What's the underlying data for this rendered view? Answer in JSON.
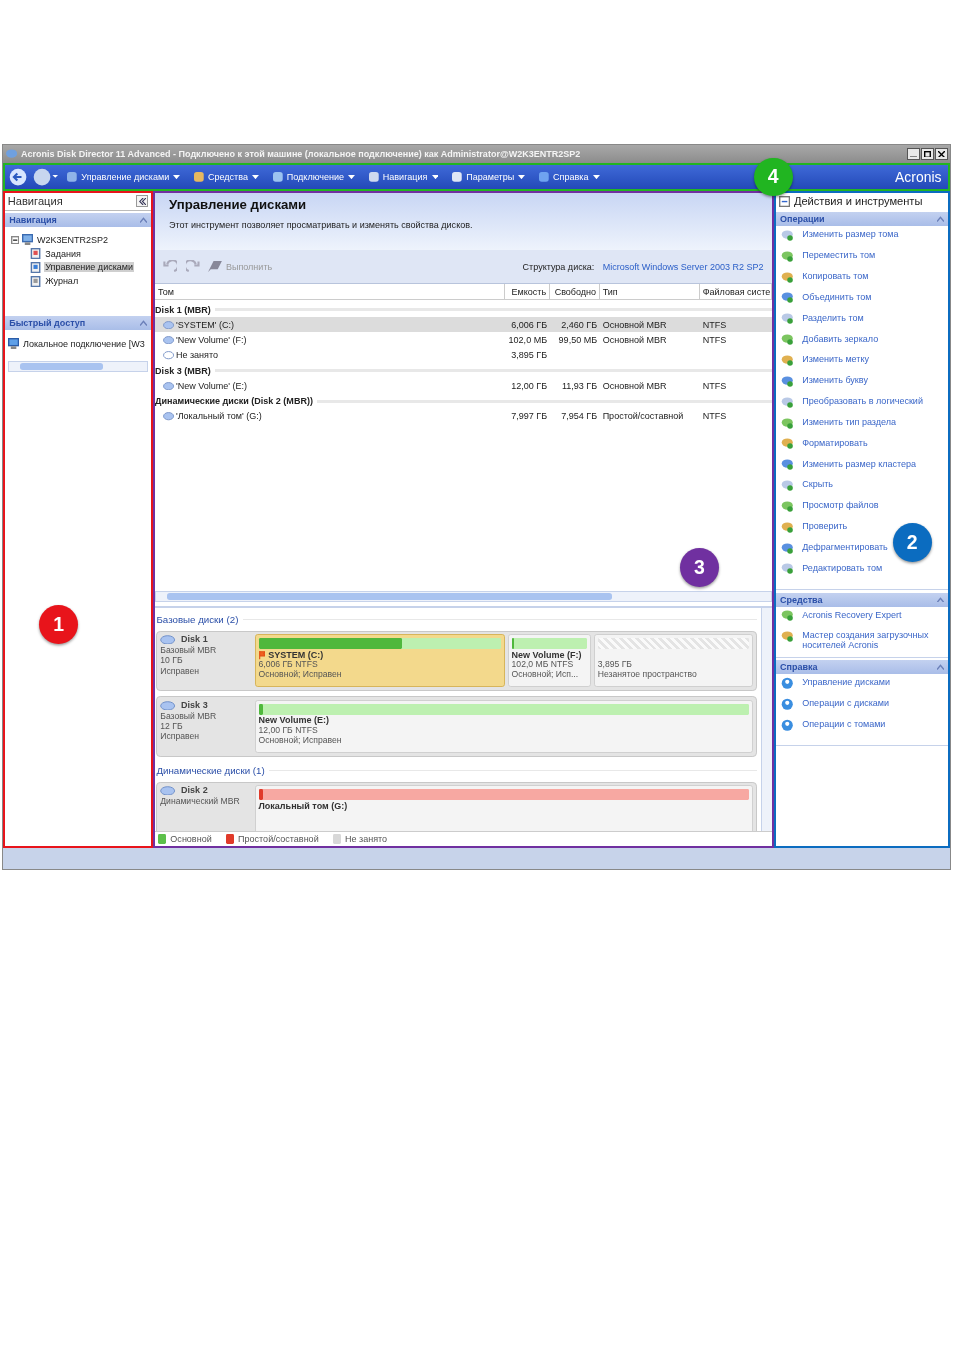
{
  "window": {
    "title": "Acronis Disk Director 11 Advanced - Подключено к этой машине (локальное подключение) как Administrator@W2K3ENTR2SP2"
  },
  "toolbar": {
    "menus": [
      "Управление дисками",
      "Средства",
      "Подключение",
      "Навигация",
      "Параметры",
      "Справка"
    ],
    "logo": "Acronis"
  },
  "navigation": {
    "title": "Навигация",
    "sections": [
      {
        "title": "Навигация",
        "tree": [
          {
            "label": "W2K3ENTR2SP2",
            "expanded": true,
            "selected": false,
            "children": [
              {
                "label": "Задания",
                "selected": false
              },
              {
                "label": "Управление дисками",
                "selected": true
              },
              {
                "label": "Журнал",
                "selected": false
              }
            ]
          }
        ]
      },
      {
        "title": "Быстрый доступ",
        "items": [
          "Локальное подключение [W3"
        ]
      }
    ]
  },
  "main": {
    "title": "Управление дисками",
    "description": "Этот инструмент позволяет просматривать и изменять свойства дисков.",
    "commit": "Выполнить",
    "layout_label": "Структура диска:",
    "layout_value": "Microsoft Windows Server 2003 R2 SP2",
    "table": {
      "columns": [
        "Том",
        "Емкость",
        "Свободно",
        "Тип",
        "Файловая систе"
      ],
      "rows": [
        {
          "kind": "group",
          "name": "Disk 1 (MBR)"
        },
        {
          "kind": "volume",
          "name": "'SYSTEM' (C:)",
          "capacity": "6,006 ГБ",
          "free": "2,460 ГБ",
          "type": "Основной MBR",
          "fs": "NTFS",
          "selected": true
        },
        {
          "kind": "volume",
          "name": "'New Volume' (F:)",
          "capacity": "102,0 МБ",
          "free": "99,50 МБ",
          "type": "Основной MBR",
          "fs": "NTFS",
          "selected": false
        },
        {
          "kind": "free",
          "name": "Не занято",
          "capacity": "3,895 ГБ",
          "selected": false
        },
        {
          "kind": "group",
          "name": "Disk 3 (MBR)"
        },
        {
          "kind": "volume",
          "name": "'New Volume' (E:)",
          "capacity": "12,00 ГБ",
          "free": "11,93 ГБ",
          "type": "Основной MBR",
          "fs": "NTFS",
          "selected": false
        },
        {
          "kind": "group",
          "name": "Динамические диски (Disk 2 (MBR))"
        },
        {
          "kind": "volume",
          "name": "'Локальный том' (G:)",
          "capacity": "7,997 ГБ",
          "free": "7,954 ГБ",
          "type": "Простой/составной",
          "fs": "NTFS",
          "selected": false
        }
      ]
    },
    "disk_groups": [
      {
        "title": "Базовые диски (2)",
        "disks": [
          {
            "name": "Disk 1",
            "type": "Базовый MBR",
            "size": "10 ГБ",
            "status": "Исправен",
            "partitions": [
              {
                "kind": "primary",
                "name": "SYSTEM (C:)",
                "size": "6,006 ГБ NTFS",
                "status": "Основной; Исправен",
                "level": 0.59,
                "selected": true,
                "active": true
              },
              {
                "kind": "primary",
                "name": "New Volume (F:)",
                "size": "102,0 МБ NTFS",
                "status": "Основной; Исп...",
                "level": 0.03,
                "selected": false,
                "active": false
              },
              {
                "kind": "unallocated",
                "size": "3,895 ГБ",
                "status": "Незанятое пространство",
                "selected": false
              }
            ]
          },
          {
            "name": "Disk 3",
            "type": "Базовый MBR",
            "size": "12 ГБ",
            "status": "Исправен",
            "partitions": [
              {
                "kind": "primary",
                "name": "New Volume (E:)",
                "size": "12,00 ГБ NTFS",
                "status": "Основной; Исправен",
                "level": 0.01,
                "selected": false,
                "active": false
              }
            ]
          }
        ]
      },
      {
        "title": "Динамические диски (1)",
        "disks": [
          {
            "name": "Disk 2",
            "type": "Динамический MBR",
            "partitions": [
              {
                "kind": "simple",
                "name": "Локальный том (G:)",
                "level": 0.01,
                "selected": false,
                "active": false
              }
            ]
          }
        ]
      }
    ],
    "legend": [
      {
        "label": "Основной",
        "color": "#5cc04a"
      },
      {
        "label": "Простой/составной",
        "color": "#e03a2a"
      },
      {
        "label": "Не занято",
        "color": "#d8d8d8"
      }
    ]
  },
  "actions": {
    "title": "Действия и инструменты",
    "sections": [
      {
        "title": "Операции",
        "items": [
          "Изменить размер тома",
          "Переместить том",
          "Копировать том",
          "Объединить том",
          "Разделить том",
          "Добавить зеркало",
          "Изменить метку",
          "Изменить букву",
          "Преобразовать в логический",
          "Изменить тип раздела",
          "Форматировать",
          "Изменить размер кластера",
          "Скрыть",
          "Просмотр файлов",
          "Проверить",
          "Дефрагментировать",
          "Редактировать том"
        ]
      },
      {
        "title": "Средства",
        "items": [
          "Acronis Recovery Expert",
          "Мастер создания загрузочных носителей Acronis"
        ]
      },
      {
        "title": "Справка",
        "items": [
          "Управление дисками",
          "Операции с дисками",
          "Операции с томами"
        ]
      }
    ]
  },
  "callouts": [
    {
      "number": "1",
      "color": "#e8141b"
    },
    {
      "number": "2",
      "color": "#0b6cc0"
    },
    {
      "number": "3",
      "color": "#7030a0"
    },
    {
      "number": "4",
      "color": "#21b521"
    }
  ]
}
